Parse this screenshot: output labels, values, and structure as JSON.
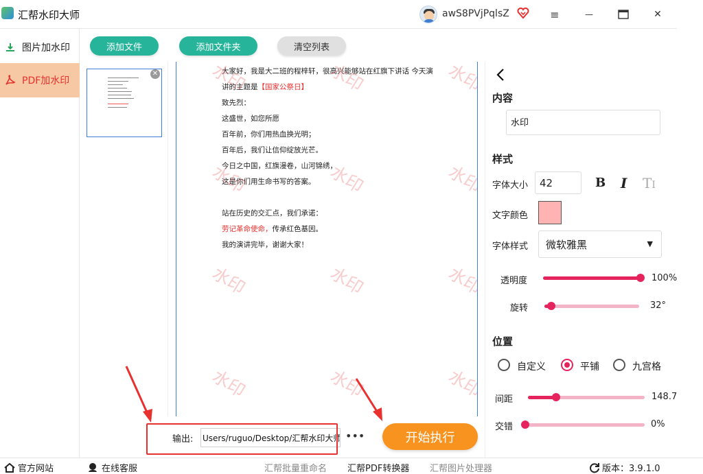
{
  "app": {
    "title": "汇帮水印大师"
  },
  "user": {
    "name": "awS8PVjPqlsZ"
  },
  "window": {
    "menu_icon": "≡",
    "minimize_icon": "—",
    "maximize_icon": "▭",
    "close_icon": "✕"
  },
  "sidebar": {
    "items": [
      {
        "label": "图片加水印",
        "active": false,
        "icon": "image-watermark-icon"
      },
      {
        "label": "PDF加水印",
        "active": true,
        "icon": "pdf-icon"
      }
    ]
  },
  "toolbar": {
    "add_file": "添加文件",
    "add_folder": "添加文件夹",
    "clear_list": "清空列表"
  },
  "preview": {
    "lines": [
      {
        "text": "大家好，我是大二班的程梓轩，很高兴能够站在红旗下讲话 今天演",
        "parts": null
      },
      {
        "prefix": "讲的主题是",
        "highlight": "【国家公祭日】",
        "suffix": ""
      },
      {
        "text": "致先烈："
      },
      {
        "text": "这盛世，如您所愿"
      },
      {
        "text": "百年前，你们用热血换光明；"
      },
      {
        "text": "百年后，我们让信仰绽放光芒。"
      },
      {
        "text": "今日之中国，红旗漫卷，山河锦绣，"
      },
      {
        "text": "这是你们用生命书写的答案。"
      },
      {
        "text": ""
      },
      {
        "text": "站在历史的交汇点，我们承诺："
      },
      {
        "prefix": "",
        "highlight": "劳记革命使命，",
        "suffix": "传承红色基因。"
      },
      {
        "text": "我的演讲完毕，谢谢大家！"
      }
    ],
    "watermark_text": "水印"
  },
  "output": {
    "label": "输出:",
    "path": "Users/ruguo/Desktop/汇帮水印大师",
    "more": "•••",
    "run_button": "开始执行"
  },
  "settings": {
    "back_icon": "chevron-left-icon",
    "content_title": "内容",
    "content_value": "水印",
    "style_title": "样式",
    "font_size_label": "字体大小",
    "font_size_value": "42",
    "bold": "B",
    "italic": "I",
    "text_style": "T",
    "text_color_label": "文字颜色",
    "text_color": "#ffb3b3",
    "font_family_label": "字体样式",
    "font_family_value": "微软雅黑",
    "opacity_label": "透明度",
    "opacity_value": "100%",
    "opacity_fraction": 1.0,
    "rotation_label": "旋转",
    "rotation_value": "32°",
    "rotation_fraction": 0.07,
    "position_title": "位置",
    "position_options": [
      "自定义",
      "平铺",
      "九宫格"
    ],
    "position_selected": "平铺",
    "spacing_label": "间距",
    "spacing_value": "148.75",
    "spacing_fraction": 0.24,
    "stagger_label": "交错",
    "stagger_value": "0%",
    "stagger_fraction": 0.0
  },
  "statusbar": {
    "official_site": "官方网站",
    "online_service": "在线客服",
    "batch_rename": "汇帮批量重命名",
    "pdf_converter": "汇帮PDF转换器",
    "image_processor": "汇帮图片处理器",
    "version": "版本：3.9.1.0"
  },
  "colors": {
    "accent_green": "#26b59a",
    "run_orange": "#f7931e",
    "active_sidebar_bg": "#f6c9a4",
    "active_red": "#e8302e",
    "slider_pink": "#e5245e"
  }
}
